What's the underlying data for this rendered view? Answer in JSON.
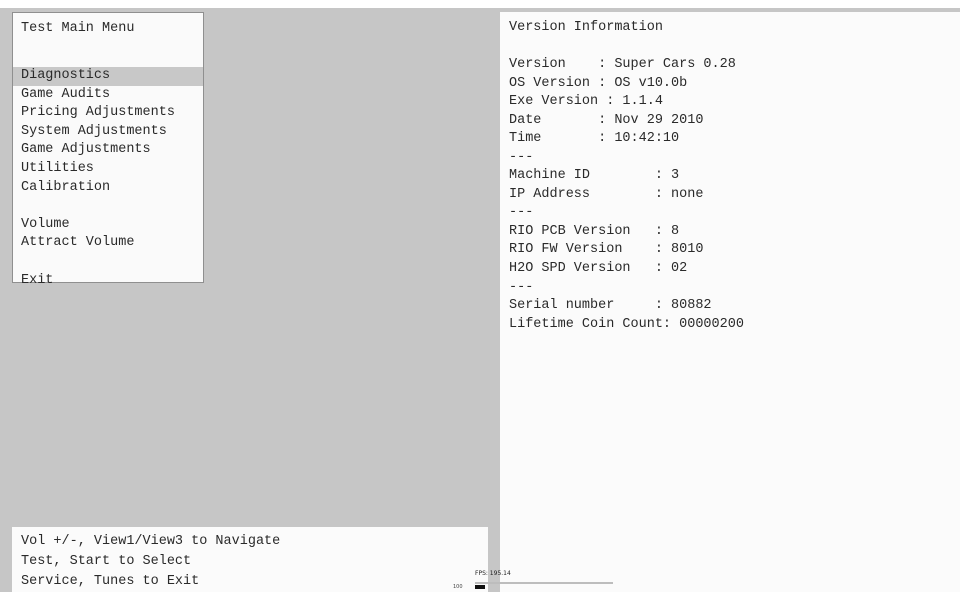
{
  "menu": {
    "title": "Test Main Menu",
    "items": [
      {
        "label": "Diagnostics",
        "selected": true
      },
      {
        "label": "Game Audits",
        "selected": false
      },
      {
        "label": "Pricing Adjustments",
        "selected": false
      },
      {
        "label": "System Adjustments",
        "selected": false
      },
      {
        "label": "Game Adjustments",
        "selected": false
      },
      {
        "label": "Utilities",
        "selected": false
      },
      {
        "label": "Calibration",
        "selected": false
      },
      {
        "label": "Volume",
        "selected": false
      },
      {
        "label": "Attract Volume",
        "selected": false
      },
      {
        "label": "Exit",
        "selected": false
      }
    ]
  },
  "info": {
    "title": "Version Information",
    "lines": [
      "Version    : Super Cars 0.28",
      "OS Version : OS v10.0b",
      "Exe Version : 1.1.4",
      "Date       : Nov 29 2010",
      "Time       : 10:42:10",
      "---",
      "Machine ID        : 3",
      "IP Address        : none",
      "---",
      "RIO PCB Version   : 8",
      "RIO FW Version    : 8010",
      "H2O SPD Version   : 02",
      "---",
      "Serial number     : 80882",
      "Lifetime Coin Count: 00000200"
    ]
  },
  "help": {
    "lines": [
      "Vol +/-, View1/View3 to Navigate",
      "Test, Start to Select",
      "Service, Tunes to Exit"
    ]
  },
  "fps": {
    "text": "FPS: 195.14",
    "marker": "100"
  },
  "colors": {
    "background": "#c6c6c6",
    "panel": "#fafafa",
    "selection": "#c8c8c8",
    "text": "#2a2a2a"
  }
}
